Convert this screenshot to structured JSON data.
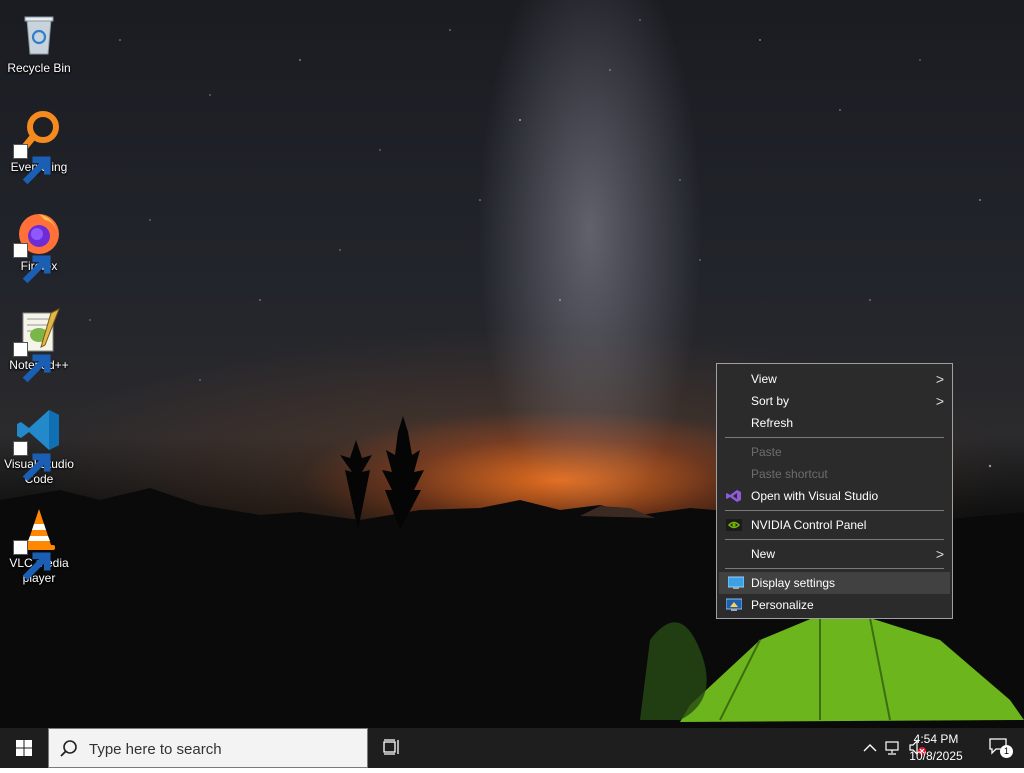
{
  "desktop": {
    "icons": [
      {
        "label": "Recycle Bin",
        "icon": "recycle-bin-icon"
      },
      {
        "label": "Everything",
        "icon": "everything-search-icon"
      },
      {
        "label": "Firefox",
        "icon": "firefox-icon"
      },
      {
        "label": "Notepad++",
        "icon": "notepad-plus-plus-icon"
      },
      {
        "label": "Visual Studio Code",
        "icon": "vscode-icon"
      },
      {
        "label": "VLC media player",
        "icon": "vlc-icon"
      }
    ]
  },
  "context_menu": {
    "view": "View",
    "sort_by": "Sort by",
    "refresh": "Refresh",
    "paste": "Paste",
    "paste_shortcut": "Paste shortcut",
    "open_with_vs": "Open with Visual Studio",
    "nvidia": "NVIDIA Control Panel",
    "new": "New",
    "display_settings": "Display settings",
    "personalize": "Personalize",
    "submenu_arrow": ">"
  },
  "taskbar": {
    "search_placeholder": "Type here to search",
    "time": "4:54 PM",
    "date": "10/8/2025",
    "notification_count": "1"
  },
  "colors": {
    "menu_bg": "#2b2b2b",
    "taskbar_bg": "#1e1e1e",
    "tent_green": "#7ed321"
  }
}
